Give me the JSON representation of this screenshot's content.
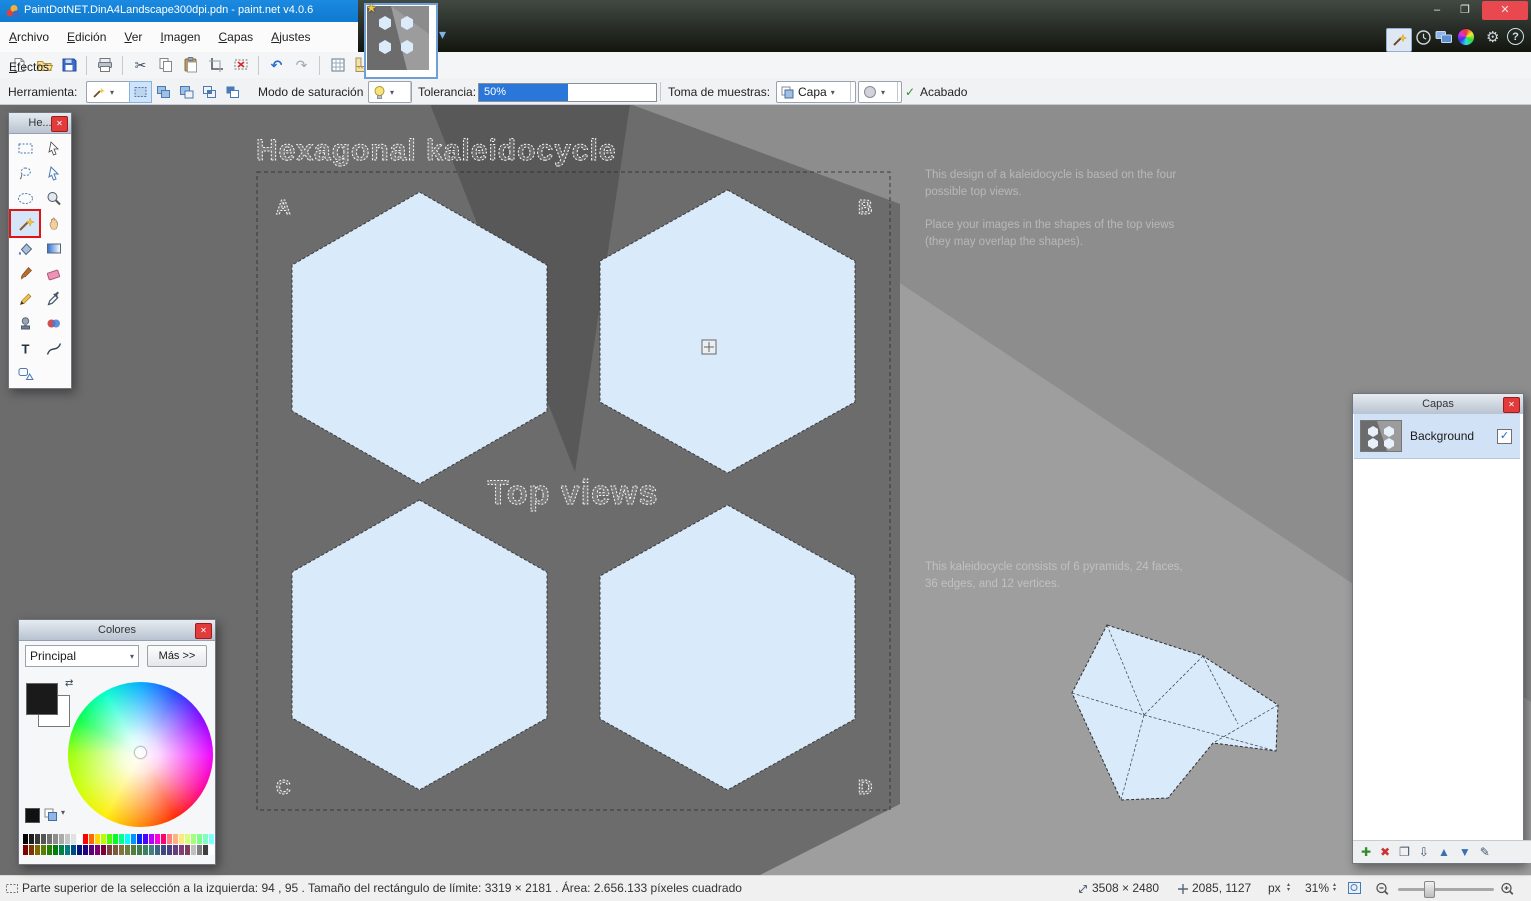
{
  "titlebar": {
    "title": "PaintDotNET.DinA4Landscape300dpi.pdn - paint.net v4.0.6"
  },
  "menu": {
    "items": [
      "Archivo",
      "Edición",
      "Ver",
      "Imagen",
      "Capas",
      "Ajustes",
      "Efectos"
    ]
  },
  "options": {
    "herramienta_label": "Herramienta:",
    "modo_label": "Modo de saturación",
    "tolerancia_label": "Tolerancia:",
    "tolerancia_value": "50%",
    "tolerancia_pct": 50,
    "muestras_label": "Toma de muestras:",
    "muestras_value": "Capa",
    "acabado_label": "Acabado"
  },
  "canvas": {
    "title": "Hexagonal kaleidocycle",
    "center_label": "Top views",
    "labels": {
      "a": "A",
      "b": "B",
      "c": "C",
      "d": "D"
    },
    "hex_fill": "#d9eafb",
    "par1": [
      "This design of a kaleidocycle is based on the four",
      "possible top views."
    ],
    "par2": [
      "Place your images in the shapes of the top views",
      "(they may overlap the shapes)."
    ],
    "par3": [
      "This kaleidocycle consists of 6 pyramids, 24 faces,",
      "36 edges, and 12 vertices."
    ]
  },
  "tools_panel": {
    "title": "He..."
  },
  "colors_panel": {
    "title": "Colores",
    "mode": "Principal",
    "more": "Más >>",
    "palette_row1": [
      "#000000",
      "#1c1c1c",
      "#383838",
      "#555555",
      "#717171",
      "#8d8d8d",
      "#aaaaaa",
      "#c6c6c6",
      "#e2e2e2",
      "#ffffff",
      "#ff0000",
      "#ff6a00",
      "#ffd800",
      "#b6ff00",
      "#4cff00",
      "#00ff21",
      "#00ff90",
      "#00ffff",
      "#0094ff",
      "#0026ff",
      "#4800ff",
      "#b200ff",
      "#ff00dc",
      "#ff006e",
      "#ff7f7f",
      "#ffb27f",
      "#ffe97f",
      "#daff7f",
      "#a5ff7f",
      "#7fff8e",
      "#7fffc5",
      "#7fffff"
    ],
    "palette_row2": [
      "#7f0000",
      "#7f3300",
      "#7f6a00",
      "#5b7f00",
      "#267f00",
      "#007f0e",
      "#007f46",
      "#007f7f",
      "#004a7f",
      "#00137f",
      "#21007f",
      "#57007f",
      "#7f006e",
      "#7f0037",
      "#7f3f3f",
      "#7f593f",
      "#7f743f",
      "#6d7f3f",
      "#527f3f",
      "#3f7f47",
      "#3f7f62",
      "#3f7f7f",
      "#3f647f",
      "#3f497f",
      "#4a3f7f",
      "#653f7f",
      "#7f3f76",
      "#7f3f5b",
      "#bfbfbf",
      "#7f7f7f",
      "#3f3f3f",
      "#ffffff"
    ]
  },
  "layers_panel": {
    "title": "Capas",
    "layers": [
      {
        "name": "Background",
        "visible": true
      }
    ]
  },
  "statusbar": {
    "selection_info": "Parte superior de la selección a la izquierda: 94 , 95 . Tamaño del rectángulo de límite: 3319 × 2181 . Área: 2.656.133 píxeles cuadrado",
    "image_size": "3508 × 2480",
    "cursor": "2085, 1127",
    "unit": "px",
    "zoom": "31%"
  },
  "icons": {
    "minimize": "–",
    "maximize": "❐",
    "close": "✕",
    "star": "★",
    "chevron_down": "▾",
    "gear": "⚙",
    "help": "?",
    "cut": "✂",
    "undo": "↶",
    "redo": "↷",
    "check": "✓",
    "swap": "⇄",
    "text_tool": "T",
    "add": "✚",
    "delete": "✖",
    "duplicate": "❐",
    "merge": "⇩",
    "move_up": "▲",
    "move_down": "▼",
    "edit": "✎",
    "spin_up": "▴",
    "spin_down": "▾"
  }
}
